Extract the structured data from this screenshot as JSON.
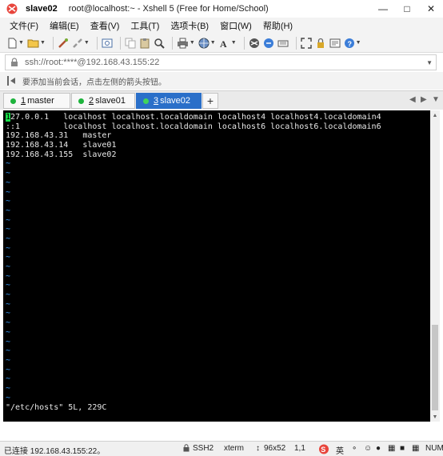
{
  "window": {
    "title": "slave02",
    "subtitle": "root@localhost:~ - Xshell 5 (Free for Home/School)"
  },
  "menu": [
    "文件(F)",
    "编辑(E)",
    "查看(V)",
    "工具(T)",
    "选项卡(B)",
    "窗口(W)",
    "帮助(H)"
  ],
  "address": {
    "value": "ssh://root:****@192.168.43.155:22"
  },
  "hint": {
    "text": "要添加当前会话，点击左侧的箭头按钮。"
  },
  "tabs": [
    {
      "num": "1",
      "label": "master"
    },
    {
      "num": "2",
      "label": "slave01"
    },
    {
      "num": "3",
      "label": "slave02"
    }
  ],
  "terminal": {
    "cursor_char": "1",
    "first_line_rest": "27.0.0.1   localhost localhost.localdomain localhost4 localhost4.localdomain4",
    "lines": [
      "::1         localhost localhost.localdomain localhost6 localhost6.localdomain6",
      "192.168.43.31   master",
      "192.168.43.14   slave01",
      "192.168.43.155  slave02"
    ],
    "tilde": "~",
    "tilde_count": 26,
    "status": "\"/etc/hosts\" 5L, 229C"
  },
  "statusbar": {
    "connection": "已连接 192.168.43.155:22。",
    "protocol": "SSH2",
    "terminal_type": "xterm",
    "size": "96x52",
    "position": "1,1",
    "ime": "英"
  },
  "colors": {
    "active_tab": "#2a6fc9",
    "connected_dot": "#1db33c",
    "cursor": "#18e04a",
    "tilde": "#3aa0ff"
  }
}
